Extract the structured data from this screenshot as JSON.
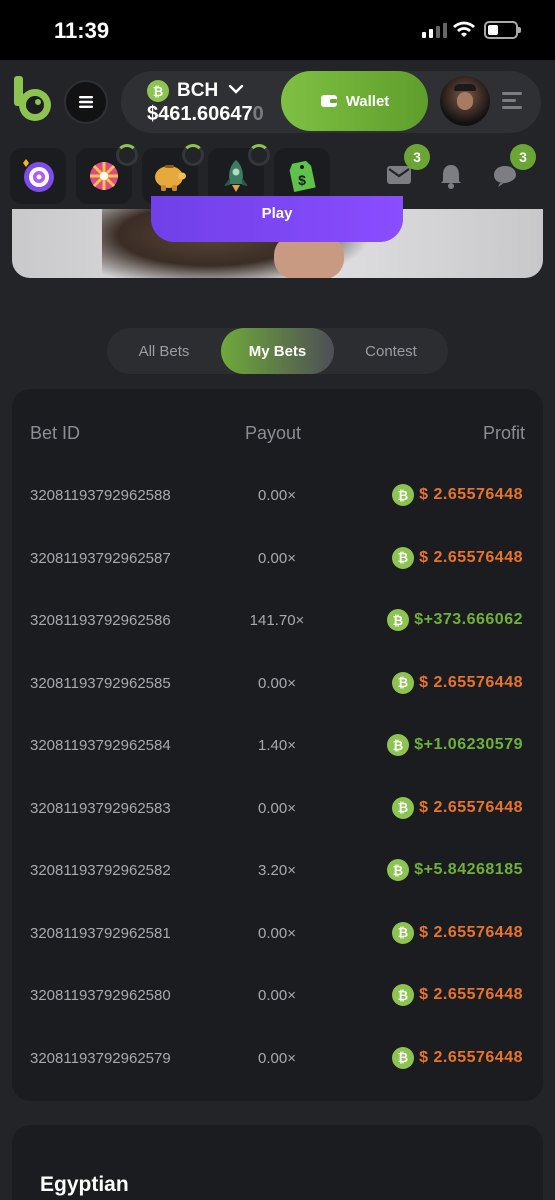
{
  "status": {
    "time": "11:39"
  },
  "balance": {
    "currency": "BCH",
    "amount": "$461.60647",
    "amount_fade": "0"
  },
  "wallet_label": "Wallet",
  "notifications": {
    "mail_count": "3",
    "chat_count": "3"
  },
  "banner": {
    "play_label": "Play"
  },
  "tabs": [
    "All Bets",
    "My Bets",
    "Contest"
  ],
  "active_tab": "My Bets",
  "table": {
    "headers": {
      "id": "Bet ID",
      "payout": "Payout",
      "profit": "Profit"
    },
    "rows": [
      {
        "id": "32081193792962588",
        "payout": "0.00×",
        "profit": "$ 2.65576448",
        "status": "loss"
      },
      {
        "id": "32081193792962587",
        "payout": "0.00×",
        "profit": "$ 2.65576448",
        "status": "loss"
      },
      {
        "id": "32081193792962586",
        "payout": "141.70×",
        "profit": "$+373.666062",
        "status": "win"
      },
      {
        "id": "32081193792962585",
        "payout": "0.00×",
        "profit": "$ 2.65576448",
        "status": "loss"
      },
      {
        "id": "32081193792962584",
        "payout": "1.40×",
        "profit": "$+1.06230579",
        "status": "win"
      },
      {
        "id": "32081193792962583",
        "payout": "0.00×",
        "profit": "$ 2.65576448",
        "status": "loss"
      },
      {
        "id": "32081193792962582",
        "payout": "3.20×",
        "profit": "$+5.84268185",
        "status": "win"
      },
      {
        "id": "32081193792962581",
        "payout": "0.00×",
        "profit": "$ 2.65576448",
        "status": "loss"
      },
      {
        "id": "32081193792962580",
        "payout": "0.00×",
        "profit": "$ 2.65576448",
        "status": "loss"
      },
      {
        "id": "32081193792962579",
        "payout": "0.00×",
        "profit": "$ 2.65576448",
        "status": "loss"
      }
    ]
  },
  "game_card": {
    "title": "Egyptian"
  },
  "colors": {
    "win": "#6fb03a",
    "loss": "#e8742c",
    "accent": "#7ec043",
    "play": "#7a46f2"
  },
  "icons": [
    "logo-icon",
    "menu-icon",
    "bch-coin-icon",
    "chevron-down-icon",
    "wallet-icon",
    "list-icon",
    "target-icon",
    "wheel-icon",
    "piggy-bank-icon",
    "rocket-icon",
    "price-tag-icon",
    "mail-icon",
    "bell-icon",
    "chat-icon"
  ]
}
